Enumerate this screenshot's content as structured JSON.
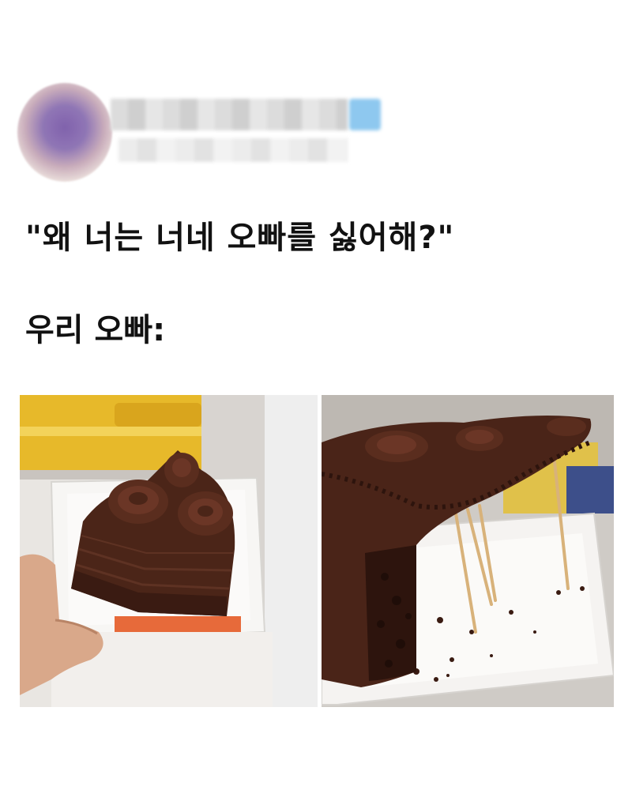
{
  "post": {
    "quote": "\"왜 너는 너네 오빠를 싫어해?\"",
    "caption": "우리 오빠:"
  },
  "images": [
    {
      "name": "whole-cake-slice-photo",
      "icon": "cake-slice-image"
    },
    {
      "name": "hollowed-cake-slice-photo",
      "icon": "cake-slice-toothpicks-image"
    }
  ],
  "colors": {
    "background": "#ffffff",
    "text": "#111111",
    "chocolate": "#4a2418",
    "plate": "#f4f2f0"
  }
}
